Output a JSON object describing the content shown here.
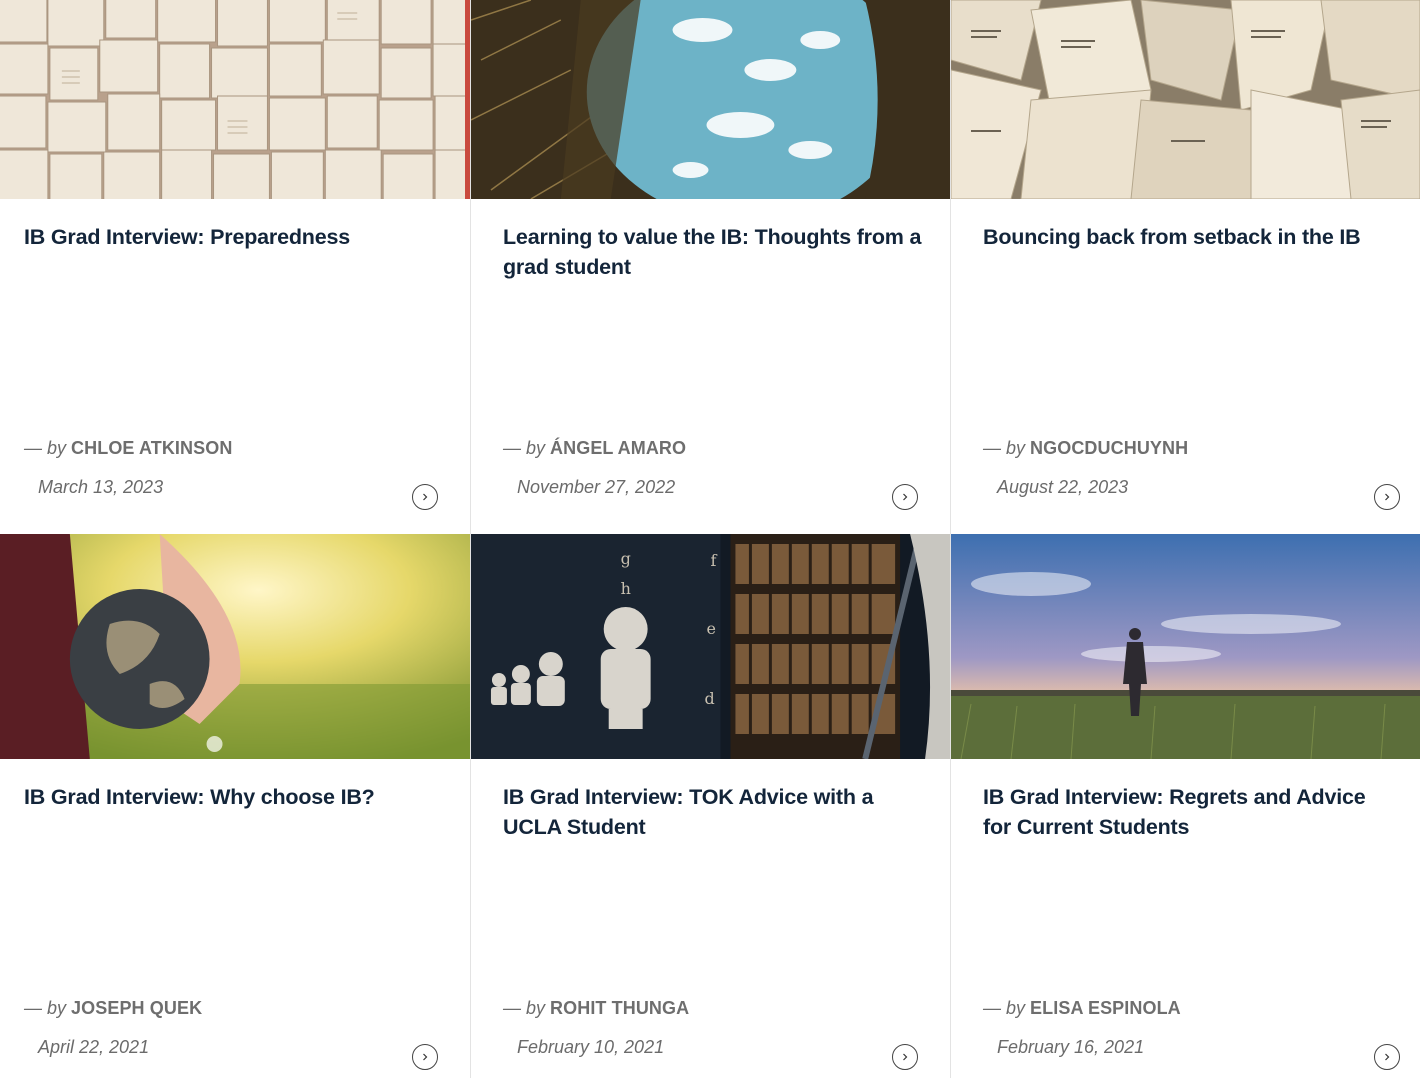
{
  "cards": [
    {
      "title": "IB Grad Interview: Preparedness",
      "by": "— by",
      "author": "CHLOE ATKINSON",
      "date": "March 13, 2023",
      "image": "open-books-collage"
    },
    {
      "title": "Learning to value the IB: Thoughts from a grad student",
      "by": "— by",
      "author": "ÁNGEL AMARO",
      "date": "November 27, 2022",
      "image": "mirror-sky-in-grass"
    },
    {
      "title": "Bouncing back from setback in the IB",
      "by": "— by",
      "author": "NGOCDUCHUYNH",
      "date": "August 22, 2023",
      "image": "crumpled-paper"
    },
    {
      "title": "IB Grad Interview: Why choose IB?",
      "by": "— by",
      "author": "JOSEPH QUEK",
      "date": "April 22, 2021",
      "image": "hand-holding-globe"
    },
    {
      "title": "IB Grad Interview: TOK Advice with a UCLA Student",
      "by": "— by",
      "author": "ROHIT THUNGA",
      "date": "February 10, 2021",
      "image": "library-busts"
    },
    {
      "title": "IB Grad Interview: Regrets and Advice for Current Students",
      "by": "— by",
      "author": "ELISA ESPINOLA",
      "date": "February 16, 2021",
      "image": "person-in-field-sunset"
    }
  ],
  "icons": {
    "arrow": "chevron-right-circle-icon"
  },
  "colors": {
    "title": "#13253a",
    "meta": "#6b6b6b",
    "border": "#e3e3e3"
  }
}
